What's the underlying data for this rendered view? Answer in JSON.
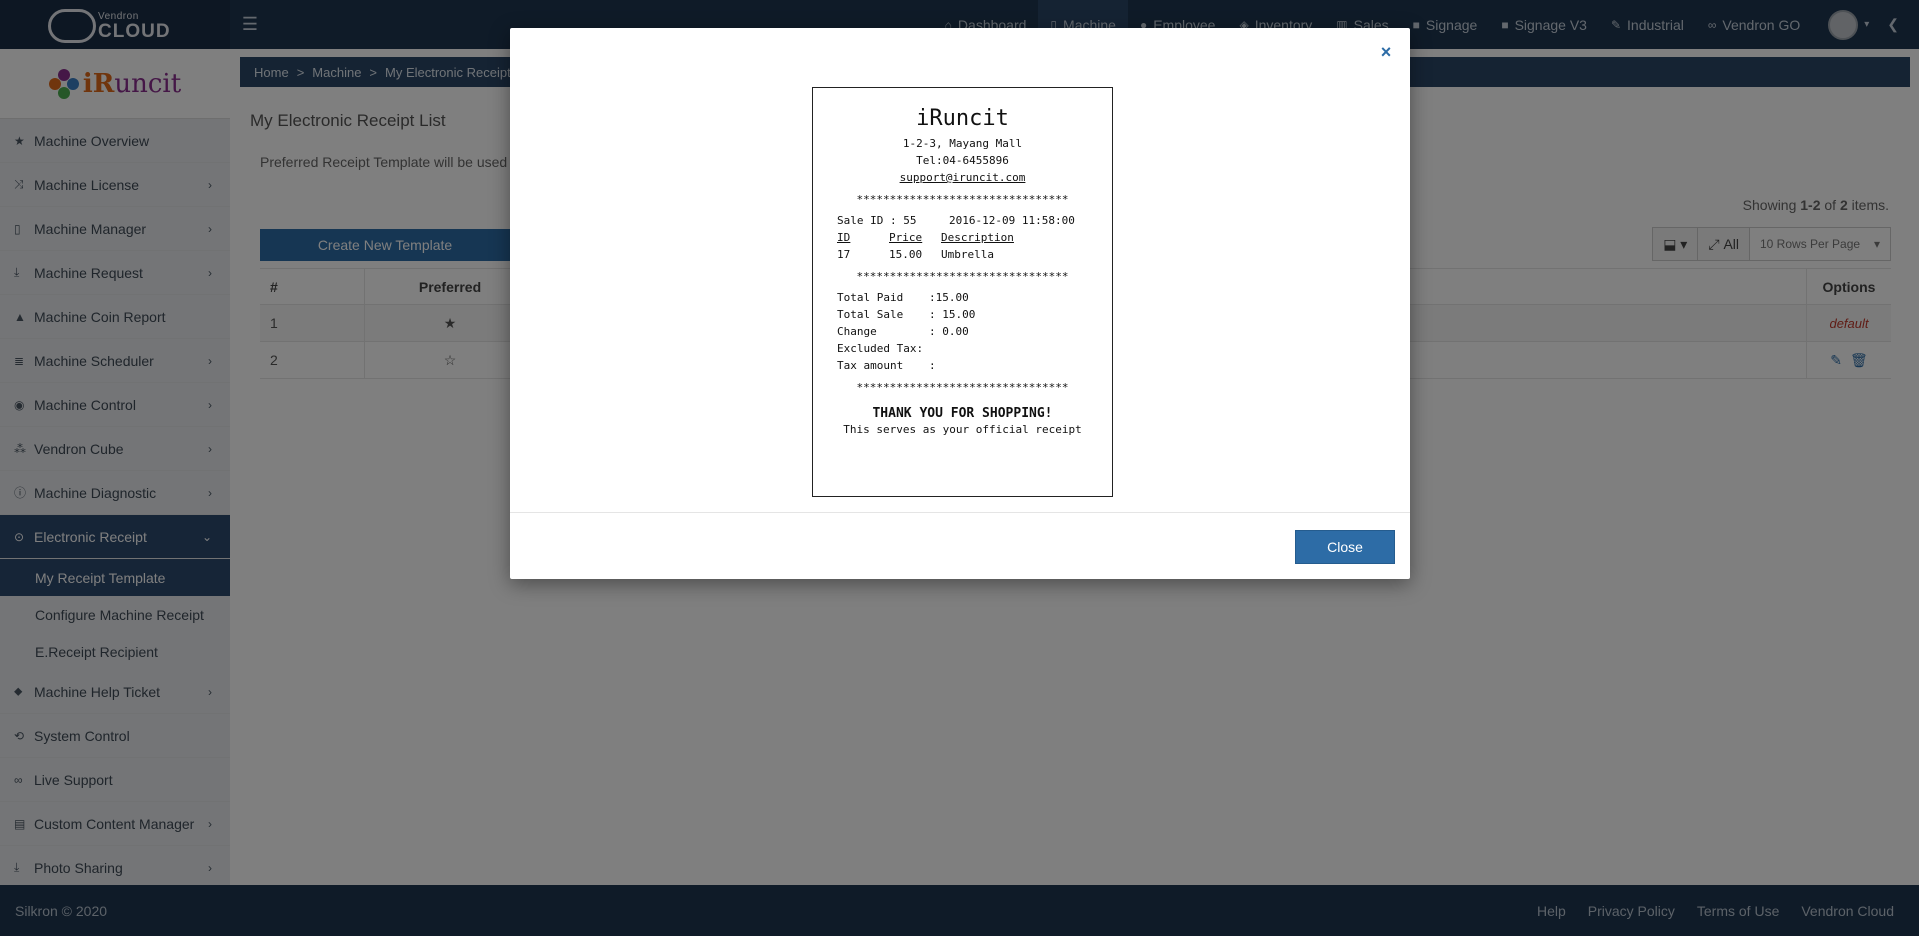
{
  "topbar": {
    "brand_small": "Vendron",
    "brand_big": "CLOUD",
    "nav": [
      {
        "label": "Dashboard",
        "icon": "home-icon"
      },
      {
        "label": "Machine",
        "icon": "machine-icon"
      },
      {
        "label": "Employee",
        "icon": "user-icon"
      },
      {
        "label": "Inventory",
        "icon": "cube-icon"
      },
      {
        "label": "Sales",
        "icon": "bar-chart-icon"
      },
      {
        "label": "Signage",
        "icon": "video-icon"
      },
      {
        "label": "Signage V3",
        "icon": "video-icon"
      },
      {
        "label": "Industrial",
        "icon": "wrench-icon"
      },
      {
        "label": "Vendron GO",
        "icon": "link-icon"
      }
    ]
  },
  "sidebar": {
    "logo_text_a": "iR",
    "logo_text_b": "uncit",
    "items": [
      {
        "label": "Machine Overview"
      },
      {
        "label": "Machine License"
      },
      {
        "label": "Machine Manager"
      },
      {
        "label": "Machine Request"
      },
      {
        "label": "Machine Coin Report"
      },
      {
        "label": "Machine Scheduler"
      },
      {
        "label": "Machine Control"
      },
      {
        "label": "Vendron Cube"
      },
      {
        "label": "Machine Diagnostic"
      },
      {
        "label": "Electronic Receipt"
      },
      {
        "label": "Machine Help Ticket"
      },
      {
        "label": "System Control"
      },
      {
        "label": "Live Support"
      },
      {
        "label": "Custom Content Manager"
      },
      {
        "label": "Photo Sharing"
      }
    ],
    "sub_items": [
      {
        "label": "My Receipt Template"
      },
      {
        "label": "Configure Machine Receipt"
      },
      {
        "label": "E.Receipt Recipient"
      }
    ]
  },
  "main": {
    "breadcrumb": [
      "Home",
      ">",
      "Machine",
      ">",
      "My Electronic Receipt List"
    ],
    "page_title": "My Electronic Receipt List",
    "info_text": "Preferred Receipt Template will be used a",
    "showing_prefix": "Showing ",
    "showing_range": "1-2",
    "showing_of": " of ",
    "showing_total": "2",
    "showing_suffix": " items.",
    "create_button": "Create New Template",
    "toolbar_all": "All",
    "rows_per_page": "10 Rows Per Page",
    "table": {
      "headers": {
        "num": "#",
        "preferred": "Preferred",
        "options": "Options"
      },
      "rows": [
        {
          "num": "1",
          "preferred": "★",
          "option": "default"
        },
        {
          "num": "2",
          "preferred": "☆",
          "option": ""
        }
      ]
    }
  },
  "modal": {
    "close_x": "×",
    "close_button": "Close",
    "receipt": {
      "title": "iRuncit",
      "address": "1-2-3, Mayang Mall",
      "tel": "Tel:04-6455896",
      "email": "support@iruncit.com",
      "stars": "********************************",
      "sale_id": "Sale ID : 55",
      "datetime": "2016-12-09 11:58:00",
      "col_id": "ID",
      "col_price": "Price",
      "col_desc": "Description",
      "item_id": "17",
      "item_price": "15.00",
      "item_desc": "Umbrella",
      "total_paid_k": "Total Paid",
      "total_paid_v": ":15.00",
      "total_sale_k": "Total Sale",
      "total_sale_v": ": 15.00",
      "change_k": "Change",
      "change_v": ": 0.00",
      "excl_tax_k": "Excluded Tax:",
      "excl_tax_v": "",
      "tax_amount_k": "Tax amount",
      "tax_amount_v": ":",
      "thanks": "THANK YOU FOR SHOPPING!",
      "official": "This serves as your official receipt"
    }
  },
  "footer": {
    "copyright": "Silkron © 2020",
    "links": [
      "Help",
      "Privacy Policy",
      "Terms of Use",
      "Vendron Cloud"
    ]
  }
}
